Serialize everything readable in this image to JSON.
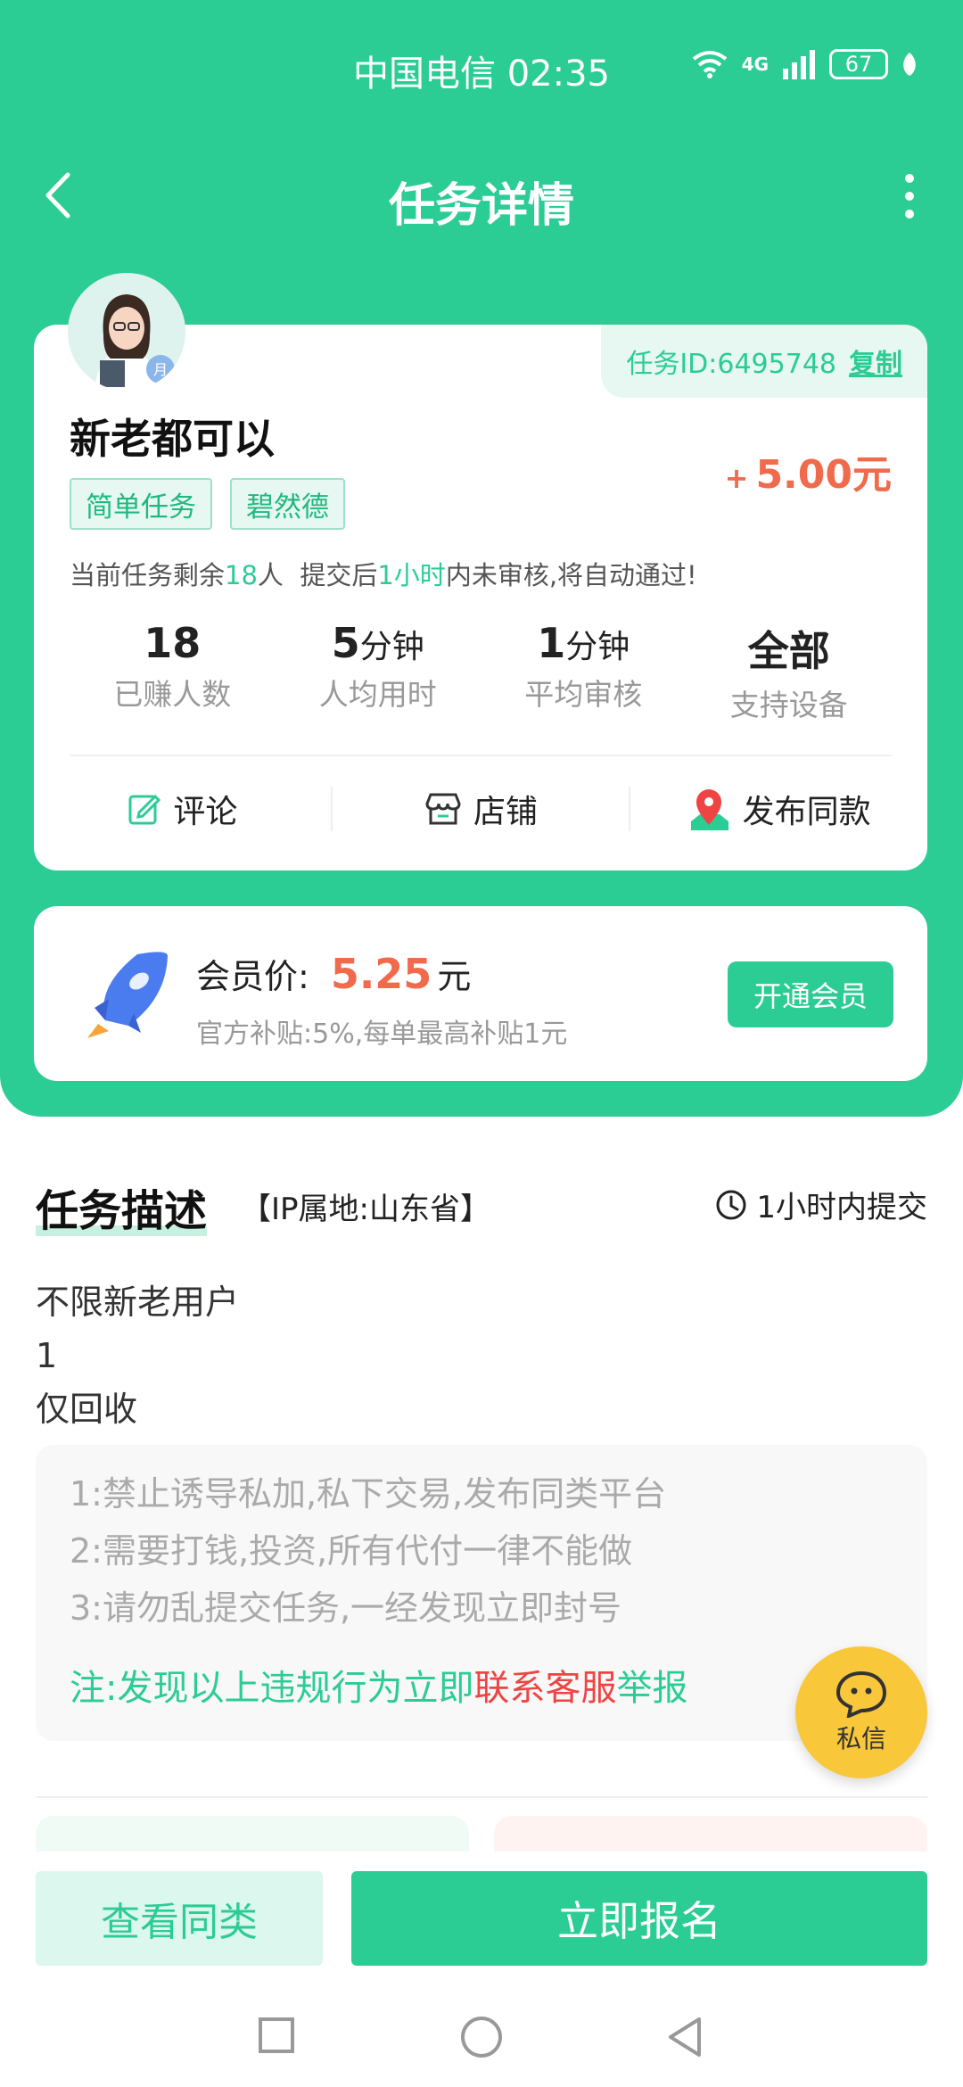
{
  "status_bar": {
    "carrier_time": "中国电信 02:35",
    "network": "4G",
    "battery": "67"
  },
  "nav": {
    "title": "任务详情"
  },
  "task": {
    "id_label": "任务ID:6495748",
    "copy_label": "复制",
    "name": "新老都可以",
    "price_plus": "+",
    "price": "5.00元",
    "tags": [
      "简单任务",
      "碧然德"
    ],
    "remain": {
      "p1": "当前任务剩余",
      "count": "18",
      "p2": "人  提交后",
      "time": "1小时",
      "p3": "内未审核,将自动通过!"
    },
    "stats": [
      {
        "value": "18",
        "unit": "",
        "label": "已赚人数"
      },
      {
        "value": "5",
        "unit": "分钟",
        "label": "人均用时"
      },
      {
        "value": "1",
        "unit": "分钟",
        "label": "平均审核"
      },
      {
        "value": "全部",
        "unit": "",
        "label": "支持设备"
      }
    ],
    "actions": {
      "comment": "评论",
      "shop": "店铺",
      "publish_same": "发布同款"
    }
  },
  "member": {
    "label": "会员价:",
    "price": "5.25",
    "unit": "元",
    "subsidy": "官方补贴:5%,每单最高补贴1元",
    "open_button": "开通会员"
  },
  "description": {
    "title": "任务描述",
    "ip": "【IP属地:山东省】",
    "deadline": "1小时内提交",
    "lines": [
      "不限新老用户",
      "1",
      "仅回收"
    ],
    "rules": [
      "1:禁止诱导私加,私下交易,发布同类平台",
      "2:需要打钱,投资,所有代付一律不能做",
      "3:请勿乱提交任务,一经发现立即封号"
    ],
    "note": {
      "p1": "注:发现以上违规行为立即",
      "link": "联系客服",
      "p2": "举报"
    }
  },
  "chat": {
    "label": "私信"
  },
  "bottom": {
    "similar": "查看同类",
    "apply": "立即报名"
  },
  "colors": {
    "primary": "#2ccc95",
    "price": "#f06a4b",
    "warn": "#ee4444",
    "chat": "#f9c73a"
  }
}
